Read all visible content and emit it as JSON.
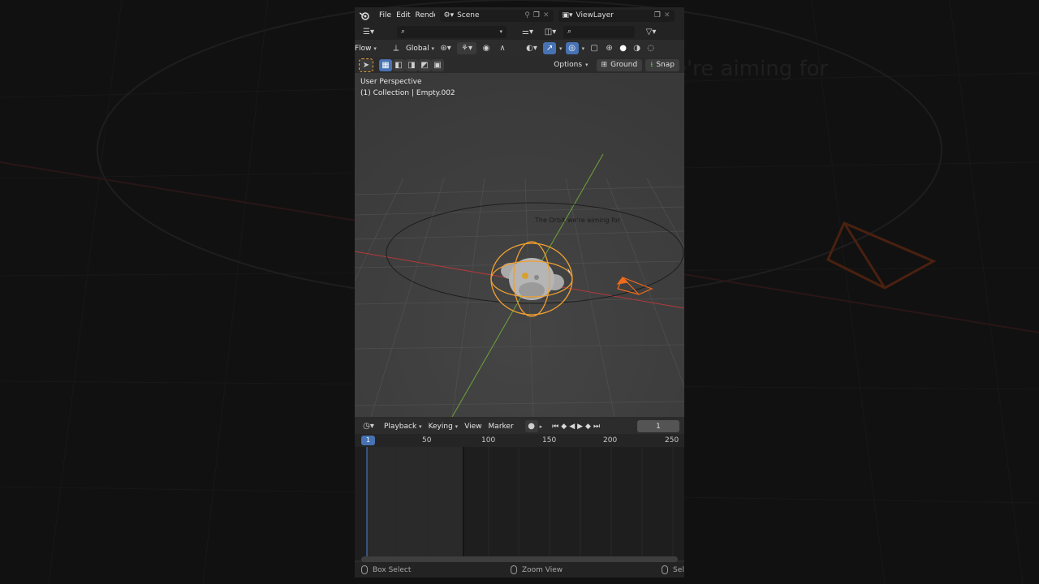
{
  "background": {
    "caption": "e're aiming for"
  },
  "topbar": {
    "menus": [
      "File",
      "Edit",
      "Rende"
    ],
    "scene": "Scene",
    "view_layer": "ViewLayer"
  },
  "header": {
    "mode": "Flow",
    "orientation": "Global",
    "options": "Options",
    "ground": "Ground",
    "snap": "Snap"
  },
  "viewport": {
    "perspective": "User Perspective",
    "collection": "(1) Collection | Empty.002",
    "orbit_label": "The Orbit we're aiming for"
  },
  "timeline": {
    "menus": [
      "Playback",
      "Keying",
      "View",
      "Marker"
    ],
    "current_frame": "1",
    "frame_badge": "1",
    "ticks": [
      "50",
      "100",
      "150",
      "200",
      "250"
    ]
  },
  "statusbar": {
    "left": "Box Select",
    "middle": "Zoom View",
    "right": "Sel"
  },
  "colors": {
    "accent": "#4772b3",
    "selection": "#f0a030",
    "x_axis": "#b5393b",
    "y_axis": "#6fa23a",
    "camera": "#f06a1a"
  },
  "icons": [
    "blender-logo-icon",
    "pin-icon",
    "copy-icon",
    "close-icon",
    "search-icon",
    "filter-icon",
    "play-icon",
    "keyframe-icon"
  ]
}
